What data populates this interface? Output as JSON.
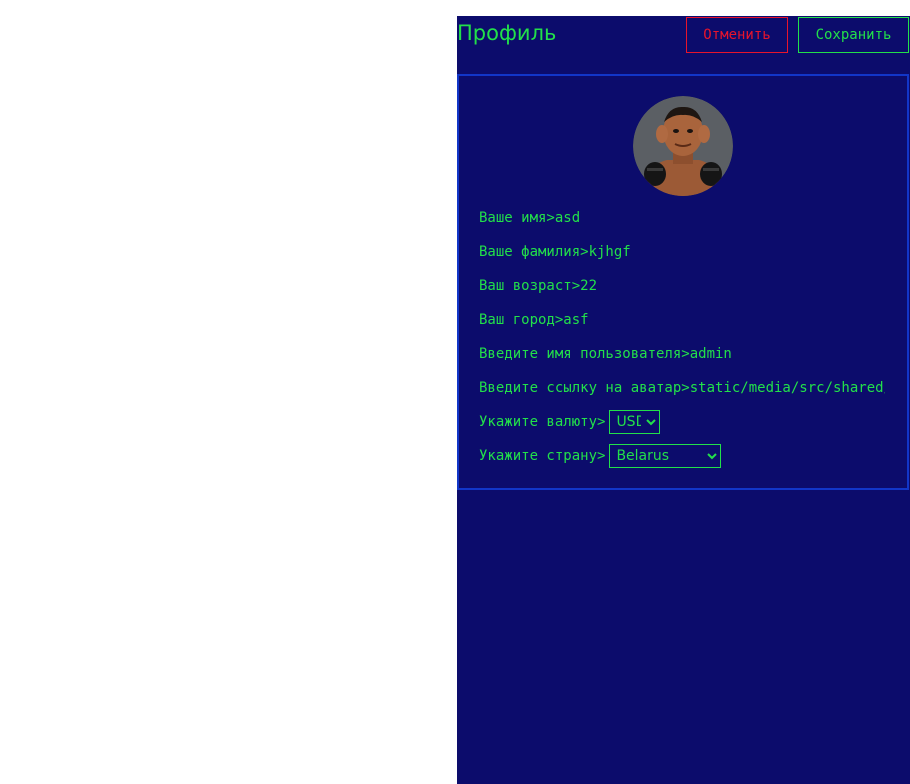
{
  "header": {
    "title": "Профиль",
    "cancel_label": "Отменить",
    "save_label": "Сохранить"
  },
  "profile": {
    "first_name_label": "Ваше имя>",
    "first_name": "asd",
    "last_name_label": "Ваше фамилия>",
    "last_name": "kjhgf",
    "age_label": "Ваш возраст>",
    "age": "22",
    "city_label": "Ваш город>",
    "city": "asf",
    "username_label": "Введите имя пользователя>",
    "username": "admin",
    "avatar_label": "Введите ссылку на аватар>",
    "avatar_url": "static/media/src/shared/assets/avatar.jpg",
    "currency_label": "Укажите валюту>",
    "currency": "USD",
    "country_label": "Укажите страну>",
    "country": "Belarus"
  },
  "colors": {
    "background": "#0c0c6c",
    "accent": "#22e04a",
    "danger": "#e8142c",
    "border": "#1236c8"
  }
}
